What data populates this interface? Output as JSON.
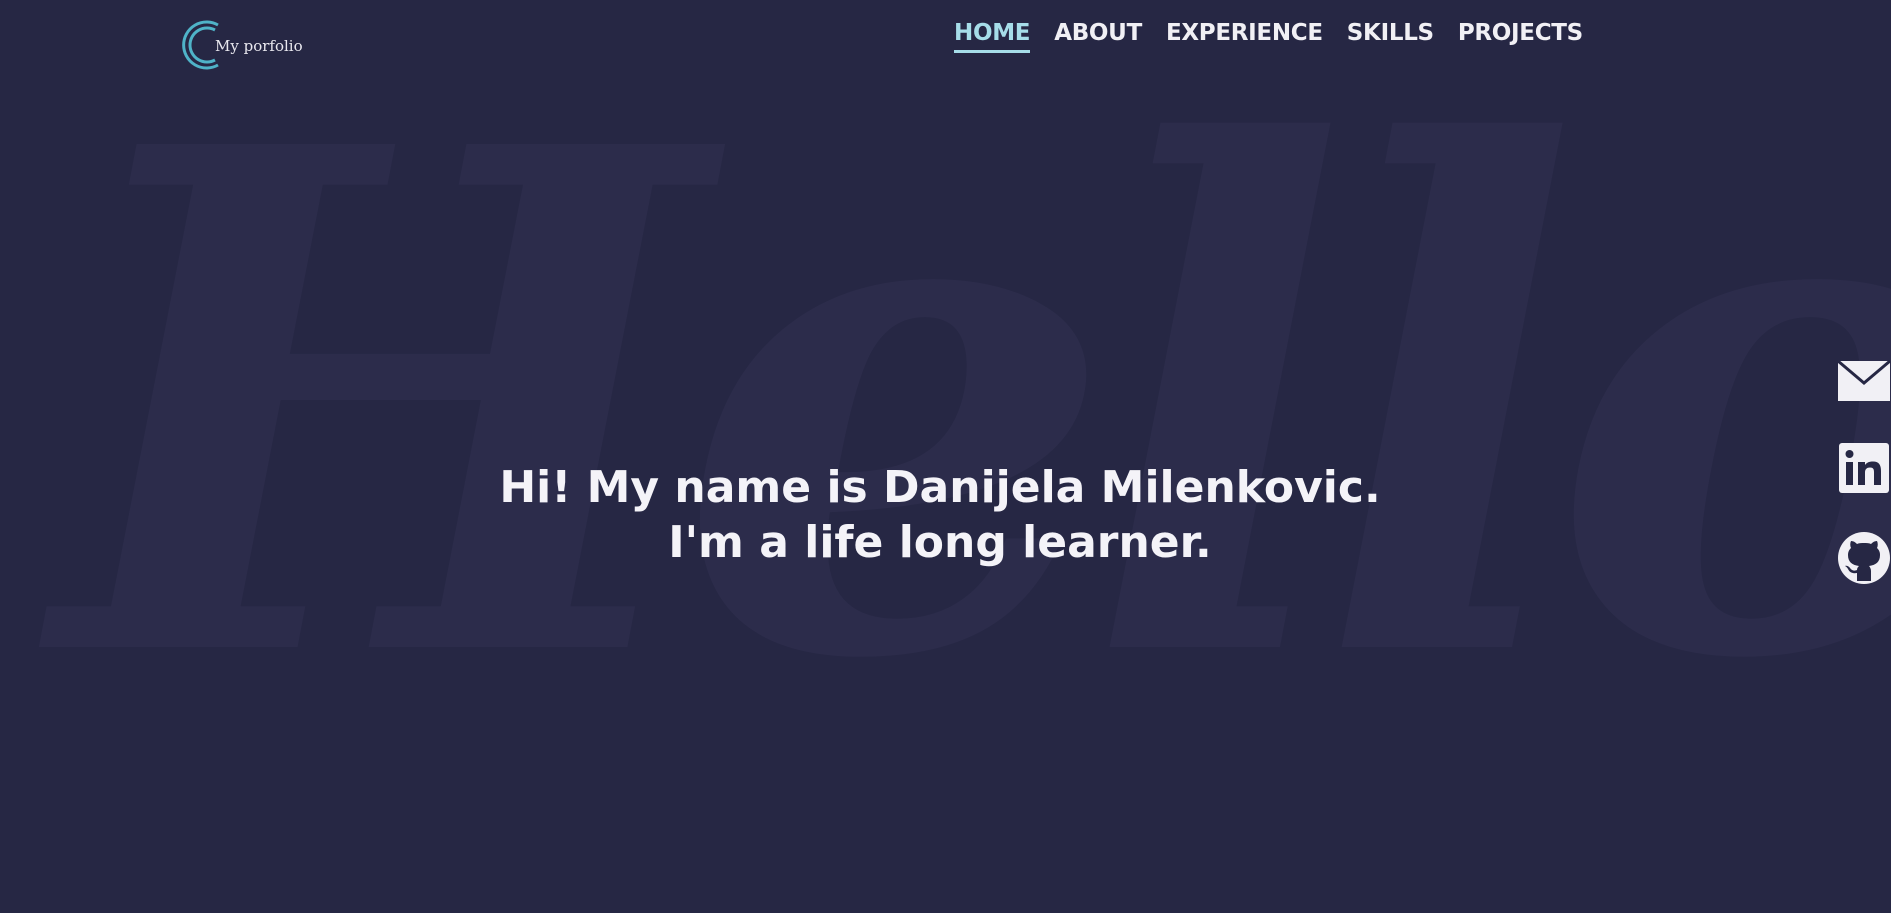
{
  "watermark": "Hello",
  "logo": {
    "text": "My porfolio",
    "icon": "c-ring-logo-icon",
    "color": "#4fb3c8"
  },
  "nav": {
    "items": [
      {
        "label": "HOME",
        "active": true
      },
      {
        "label": "ABOUT",
        "active": false
      },
      {
        "label": "EXPERIENCE",
        "active": false
      },
      {
        "label": "SKILLS",
        "active": false
      },
      {
        "label": "PROJECTS",
        "active": false
      }
    ]
  },
  "hero": {
    "line1": "Hi! My name is Danijela Milenkovic.",
    "line2": "I'm a life long learner."
  },
  "social": {
    "items": [
      {
        "icon": "mail-icon"
      },
      {
        "icon": "linkedin-icon"
      },
      {
        "icon": "github-icon"
      }
    ]
  },
  "colors": {
    "background": "#262744",
    "accent": "#a6dde9",
    "text": "#f1f0f5",
    "watermark": "#2c2c4b"
  }
}
